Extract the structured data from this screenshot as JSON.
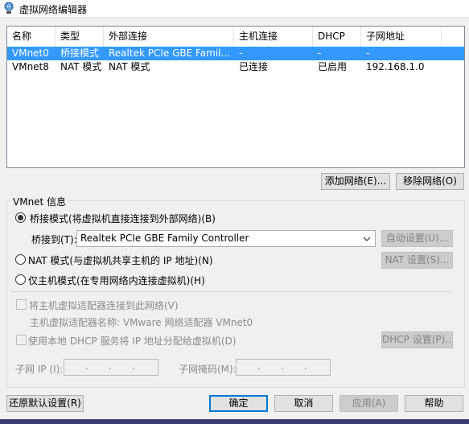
{
  "window": {
    "title": "虚拟网络编辑器"
  },
  "table": {
    "columns": [
      "名称",
      "类型",
      "外部连接",
      "主机连接",
      "DHCP",
      "子网地址"
    ],
    "rows": [
      [
        "VMnet0",
        "桥接模式",
        "Realtek PCIe GBE Family Co...",
        "-",
        "-",
        "-"
      ],
      [
        "VMnet8",
        "NAT 模式",
        "NAT 模式",
        "已连接",
        "已启用",
        "192.168.1.0"
      ]
    ],
    "selected_row": 0
  },
  "buttons": {
    "add_network": "添加网络(E)...",
    "remove_network": "移除网络(O)",
    "auto_settings": "自动设置(U)...",
    "nat_settings": "NAT 设置(S)...",
    "dhcp_settings": "DHCP 设置(P)...",
    "restore_defaults": "还原默认设置(R)",
    "ok": "确定",
    "cancel": "取消",
    "apply": "应用(A)",
    "help": "帮助"
  },
  "info": {
    "group_title": "VMnet 信息",
    "bridged_label": "桥接模式(将虚拟机直接连接到外部网络)(B)",
    "bridged_to_label": "桥接到(T):",
    "bridged_to_value": "Realtek PCIe GBE Family Controller",
    "nat_label": "NAT 模式(与虚拟机共享主机的 IP 地址)(N)",
    "hostonly_label": "仅主机模式(在专用网络内连接虚拟机)(H)",
    "connect_adapter_label": "将主机虚拟适配器连接到此网络(V)",
    "adapter_name_label": "主机虚拟适配器名称: VMware 网络适配器 VMnet0",
    "dhcp_label": "使用本地 DHCP 服务将 IP 地址分配给虚拟机(D)",
    "subnet_ip_label": "子网 IP (I):",
    "subnet_mask_label": "子网掩码(M):",
    "ip_dots": "."
  },
  "selected_mode": "bridged",
  "colors": {
    "selection": "#3399ff",
    "default_button_border": "#0078d7",
    "bottom_bar": "#3c3c78"
  }
}
